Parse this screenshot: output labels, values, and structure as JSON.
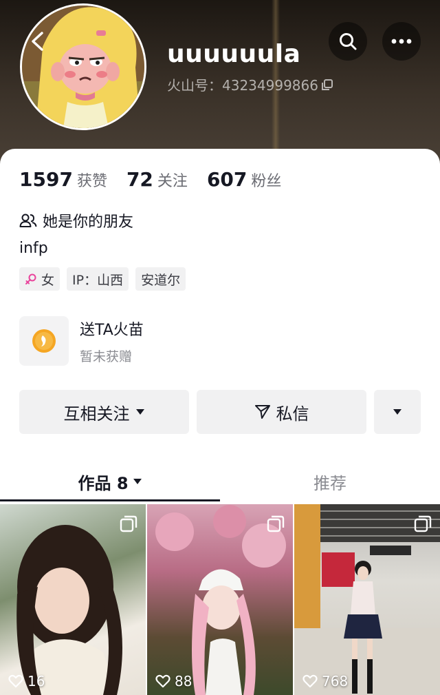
{
  "profile": {
    "username": "uuuuuula",
    "id_text": "火山号：43234999866",
    "stats": [
      {
        "num": "1597",
        "label": "获赞"
      },
      {
        "num": "72",
        "label": "关注"
      },
      {
        "num": "607",
        "label": "粉丝"
      }
    ],
    "relation": "她是你的朋友",
    "bio": "infp",
    "tags": {
      "gender": "女",
      "ip": "IP：山西",
      "location": "安道尔"
    }
  },
  "gift": {
    "title": "送TA火苗",
    "subtitle": "暂未获赠"
  },
  "actions": {
    "follow_label": "互相关注",
    "message_label": "私信"
  },
  "tabs": {
    "works_label": "作品 8",
    "recommend_label": "推荐"
  },
  "posts": [
    {
      "likes": "16"
    },
    {
      "likes": "88"
    },
    {
      "likes": "768"
    }
  ],
  "icons": {
    "back": "chevron-left-icon",
    "search": "search-icon",
    "more": "more-dots-icon",
    "copy": "copy-icon",
    "friends": "friends-icon",
    "gender": "female-icon",
    "gift": "flame-coin-icon",
    "message": "send-icon",
    "dropdown": "caret-down-icon",
    "multi_image": "multi-image-icon",
    "like": "heart-icon"
  },
  "colors": {
    "gender_pink": "#e9449c",
    "gift_orange": "#f5a623",
    "text_primary": "#161823"
  }
}
